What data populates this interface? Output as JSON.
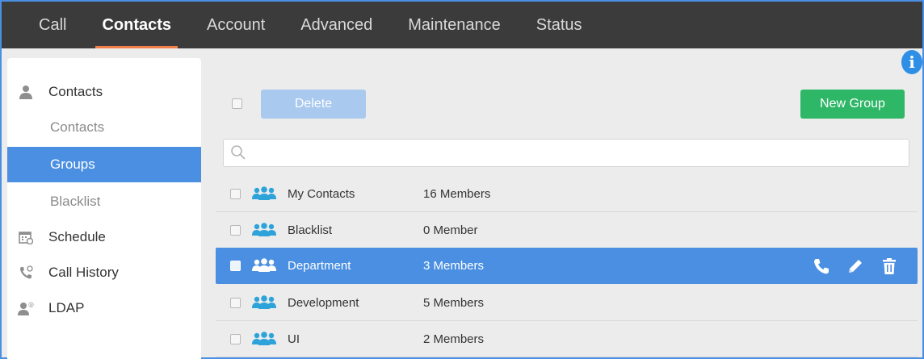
{
  "nav": {
    "tabs": [
      {
        "label": "Call"
      },
      {
        "label": "Contacts"
      },
      {
        "label": "Account"
      },
      {
        "label": "Advanced"
      },
      {
        "label": "Maintenance"
      },
      {
        "label": "Status"
      }
    ],
    "active": "Contacts"
  },
  "sidebar": {
    "items": [
      {
        "label": "Contacts",
        "icon": "person-icon"
      },
      {
        "label": "Contacts"
      },
      {
        "label": "Groups"
      },
      {
        "label": "Blacklist"
      },
      {
        "label": "Schedule",
        "icon": "calendar-icon"
      },
      {
        "label": "Call History",
        "icon": "call-history-icon"
      },
      {
        "label": "LDAP",
        "icon": "ldap-icon"
      }
    ],
    "selected": "Groups"
  },
  "toolbar": {
    "delete_label": "Delete",
    "new_group_label": "New Group"
  },
  "search": {
    "placeholder": ""
  },
  "groups": {
    "rows": [
      {
        "name": "My Contacts",
        "members": "16 Members"
      },
      {
        "name": "Blacklist",
        "members": "0 Member"
      },
      {
        "name": "Department",
        "members": "3 Members"
      },
      {
        "name": "Development",
        "members": "5 Members"
      },
      {
        "name": "UI",
        "members": "2 Members"
      }
    ],
    "selected_row": "Department"
  },
  "colors": {
    "accent": "#4a8fe2",
    "nav_bg": "#3b3b3b",
    "active_underline": "#f07f4a",
    "new_group": "#2db766",
    "delete_disabled": "#a9c9ee",
    "group_icon": "#2ea3d9"
  },
  "info_icon": {
    "glyph": "i"
  }
}
